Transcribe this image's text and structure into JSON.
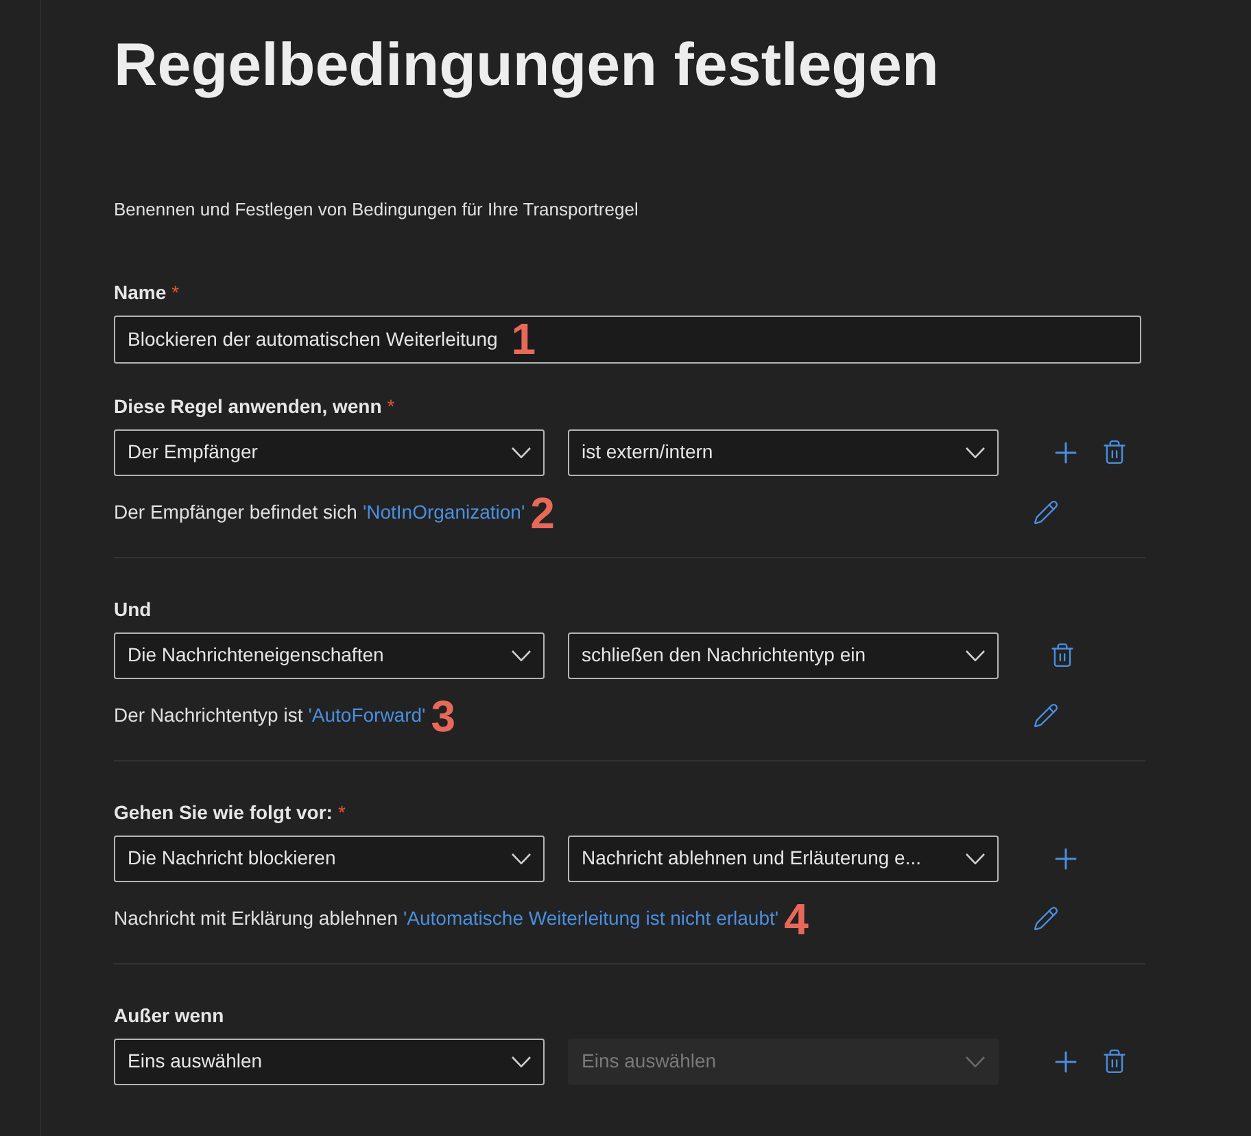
{
  "title": "Regelbedingungen festlegen",
  "subtitle": "Benennen und Festlegen von Bedingungen für Ihre Transportregel",
  "name_field": {
    "label": "Name",
    "required_mark": "*",
    "value": "Blockieren der automatischen Weiterleitung",
    "callout": "1"
  },
  "sections": [
    {
      "label": "Diese Regel anwenden, wenn",
      "required_mark": "*",
      "dropdowns": [
        {
          "value": "Der Empfänger",
          "disabled": false
        },
        {
          "value": "ist extern/intern",
          "disabled": false
        }
      ],
      "actions": [
        {
          "kind": "add"
        },
        {
          "kind": "delete"
        }
      ],
      "description": "Der Empfänger befindet sich",
      "link": "'NotInOrganization'",
      "callout": "2"
    },
    {
      "label": "Und",
      "dropdowns": [
        {
          "value": "Die Nachrichteneigenschaften",
          "disabled": false
        },
        {
          "value": "schließen den Nachrichtentyp ein",
          "disabled": false
        }
      ],
      "actions": [
        {
          "kind": "delete"
        }
      ],
      "description": "Der Nachrichtentyp ist",
      "link": "'AutoForward'",
      "callout": "3"
    },
    {
      "label": "Gehen Sie wie folgt vor:",
      "required_mark": "*",
      "dropdowns": [
        {
          "value": "Die Nachricht blockieren",
          "disabled": false
        },
        {
          "value": "Nachricht ablehnen und Erläuterung e...",
          "disabled": false
        }
      ],
      "actions": [
        {
          "kind": "add"
        }
      ],
      "description": "Nachricht mit Erklärung ablehnen",
      "link": "'Automatische Weiterleitung ist nicht erlaubt'",
      "callout": "4"
    },
    {
      "label": "Außer wenn",
      "dropdowns": [
        {
          "value": "Eins auswählen",
          "disabled": false
        },
        {
          "value": "Eins auswählen",
          "disabled": true
        }
      ],
      "actions": [
        {
          "kind": "add"
        },
        {
          "kind": "delete"
        }
      ]
    }
  ]
}
